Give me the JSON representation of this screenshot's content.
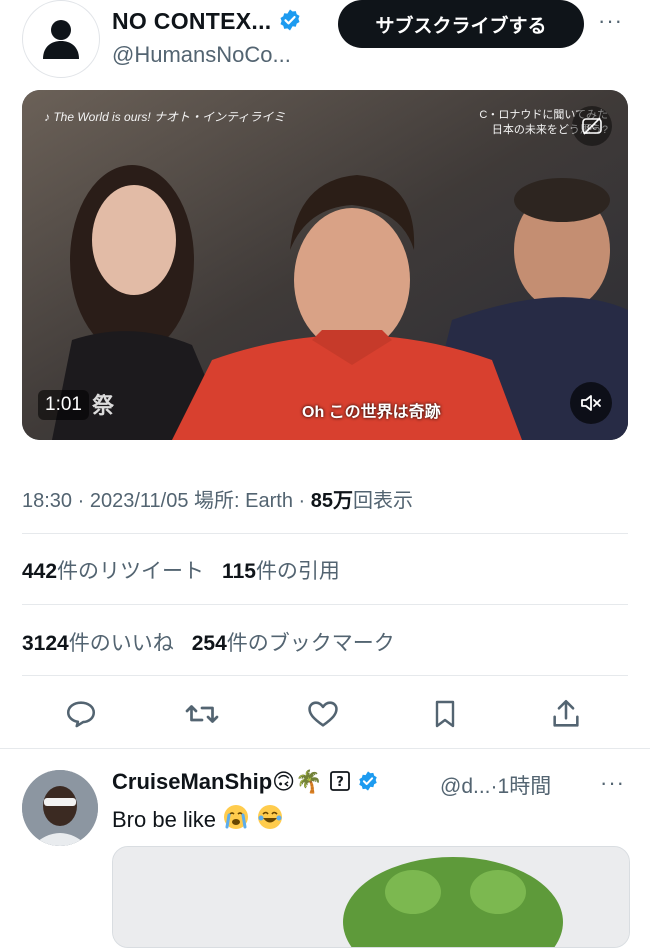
{
  "header": {
    "display_name": "NO CONTEX...",
    "handle": "@HumansNoCo...",
    "subscribe_label": "サブスクライブする",
    "more_label": "···"
  },
  "video": {
    "top_left_caption": "♪ The World is ours!  ナオト・インティライミ",
    "top_right_caption_1": "C・ロナウドに聞いてみた",
    "top_right_caption_2": "日本の未来をどう思う?",
    "overlay_text": "祭",
    "subtitle": "Oh この世界は奇跡",
    "duration": "1:01"
  },
  "meta": {
    "time": "18:30",
    "date": "2023/11/05",
    "location_label": "場所: Earth",
    "views_value": "85万",
    "views_label": "回表示",
    "separator": " · "
  },
  "stats": {
    "retweets_value": "442",
    "retweets_label": "件のリツイート",
    "quotes_value": "115",
    "quotes_label": "件の引用",
    "likes_value": "3124",
    "likes_label": "件のいいね",
    "bookmarks_value": "254",
    "bookmarks_label": "件のブックマーク"
  },
  "reply": {
    "display_name": "CruiseManShip",
    "name_emojis": "🙃🌴",
    "handle": "@d...",
    "dot": "·",
    "time": "1時間",
    "more_label": "···",
    "text": "Bro be like"
  },
  "colors": {
    "verified": "#1d9bf0",
    "secondary_text": "#536471",
    "primary_text": "#0f1419",
    "subscribe_bg": "#0f1419"
  }
}
